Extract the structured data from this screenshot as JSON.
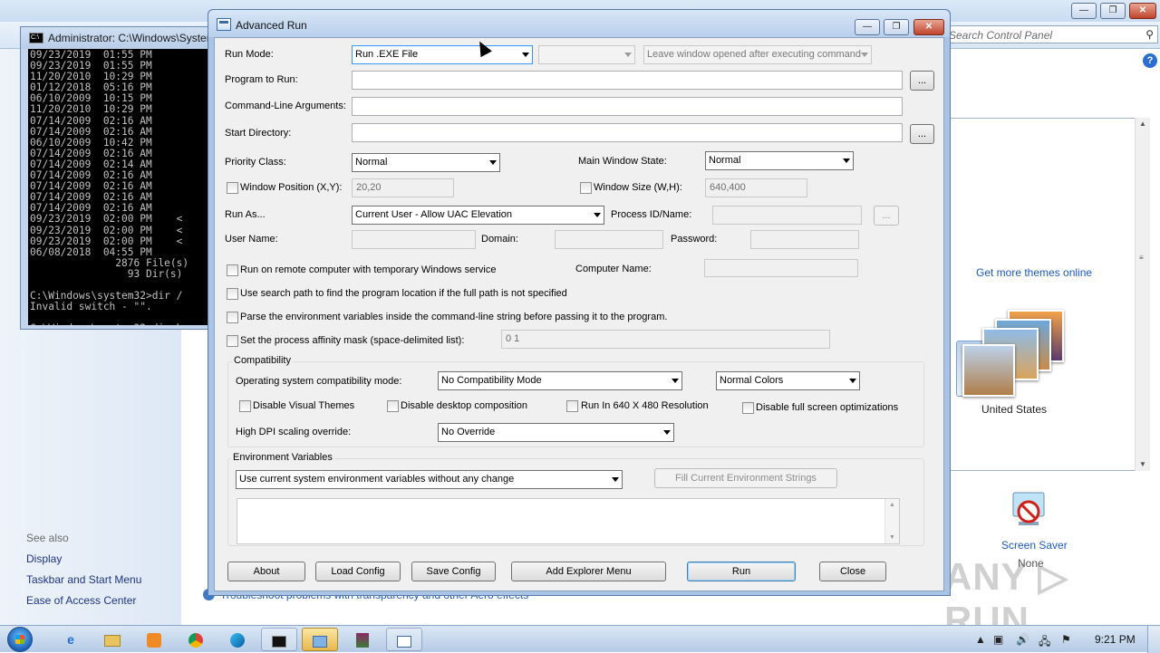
{
  "control_panel": {
    "search_placeholder": "Search Control Panel",
    "help_glyph": "?",
    "window_buttons": [
      "—",
      "❐",
      "✕"
    ],
    "see_also_heading": "See also",
    "see_also_links": [
      "Display",
      "Taskbar and Start Menu",
      "Ease of Access Center"
    ],
    "get_more_themes": "Get more themes online",
    "theme_name": "United States",
    "screen_saver_label": "Screen Saver",
    "screen_saver_value": "None",
    "troubleshoot_link": "Troubleshoot problems with transparency and other Aero effects",
    "watermark": "ANY ▷ RUN"
  },
  "cmd": {
    "title": "Administrator: C:\\Windows\\System32\\cmd.exe",
    "icon_text": "C:\\",
    "lines": [
      "09/23/2019  01:55 PM",
      "09/23/2019  01:55 PM",
      "11/20/2010  10:29 PM",
      "01/12/2018  05:16 PM",
      "06/10/2009  10:15 PM",
      "11/20/2010  10:29 PM",
      "07/14/2009  02:16 AM",
      "07/14/2009  02:16 AM",
      "06/10/2009  10:42 PM",
      "07/14/2009  02:16 AM",
      "07/14/2009  02:14 AM",
      "07/14/2009  02:16 AM",
      "07/14/2009  02:16 AM",
      "07/14/2009  02:16 AM",
      "07/14/2009  02:16 AM",
      "09/23/2019  02:00 PM    <",
      "09/23/2019  02:00 PM    <",
      "09/23/2019  02:00 PM    <",
      "06/08/2018  04:55 PM",
      "              2876 File(s)",
      "                93 Dir(s)",
      "",
      "C:\\Windows\\system32>dir /",
      "Invalid switch - \"\".",
      "",
      "C:\\Windows\\system32>dir h"
    ]
  },
  "advanced_run": {
    "title": "Advanced Run",
    "window_buttons": {
      "minimize": "—",
      "maximize": "❐",
      "close": "✕"
    },
    "run_mode_label": "Run Mode:",
    "run_mode_value": "Run .EXE File",
    "run_mode_secondary_value": "",
    "leave_window_value": "Leave window opened after executing command",
    "program_to_run_label": "Program to Run:",
    "command_line_label": "Command-Line Arguments:",
    "start_directory_label": "Start Directory:",
    "browse_label": "...",
    "priority_class_label": "Priority Class:",
    "priority_class_value": "Normal",
    "main_window_state_label": "Main Window State:",
    "main_window_state_value": "Normal",
    "window_position_label": "Window Position (X,Y):",
    "window_position_value": "20,20",
    "window_size_label": "Window Size (W,H):",
    "window_size_value": "640,400",
    "run_as_label": "Run As...",
    "run_as_value": "Current User - Allow UAC Elevation",
    "process_id_label": "Process ID/Name:",
    "user_name_label": "User Name:",
    "domain_label": "Domain:",
    "password_label": "Password:",
    "remote_computer_label": "Run on remote computer with temporary Windows service",
    "computer_name_label": "Computer Name:",
    "search_path_label": "Use search path to find the program location if the full path is not specified",
    "parse_env_label": "Parse the environment variables inside the command-line string before passing it to the program.",
    "affinity_label": "Set the process affinity mask (space-delimited list):",
    "affinity_value": "0 1",
    "compatibility_group": "Compatibility",
    "os_compat_label": "Operating system compatibility mode:",
    "os_compat_value": "No Compatibility Mode",
    "colors_value": "Normal Colors",
    "disable_visual_themes": "Disable Visual Themes",
    "disable_desktop_composition": "Disable desktop composition",
    "run_640": "Run In 640 X 480 Resolution",
    "disable_fullscreen_opt": "Disable full screen optimizations",
    "high_dpi_label": "High DPI scaling override:",
    "high_dpi_value": "No Override",
    "env_group": "Environment Variables",
    "env_mode_value": "Use current system environment variables without any change",
    "fill_env_button": "Fill Current Environment Strings",
    "buttons": {
      "about": "About",
      "load_config": "Load Config",
      "save_config": "Save Config",
      "add_explorer_menu": "Add Explorer Menu",
      "run": "Run",
      "close": "Close"
    }
  },
  "taskbar": {
    "items": [
      "IE",
      "Explorer",
      "Media Player",
      "Chrome",
      "Edge",
      "Command Prompt",
      "Control Panel",
      "WinRAR",
      "Advanced Run"
    ],
    "tray_icons": [
      "▲",
      "▣",
      "🔊",
      "🖧",
      "⚑"
    ],
    "clock": "9:21 PM"
  }
}
